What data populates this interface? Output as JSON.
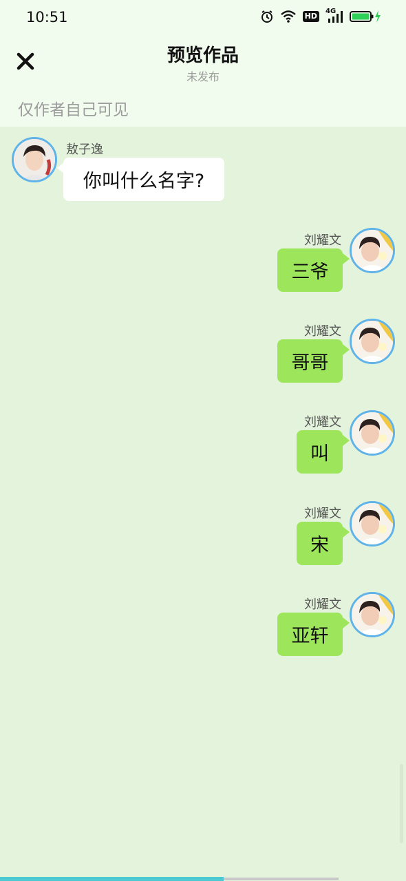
{
  "status_bar": {
    "time": "10:51",
    "hd_label": "HD",
    "network_label": "4G",
    "battery_color": "#2fd05a"
  },
  "header": {
    "title": "预览作品",
    "subtitle": "未发布",
    "visibility_note": "仅作者自己可见"
  },
  "messages": [
    {
      "side": "left",
      "sender": "敖子逸",
      "text": "你叫什么名字?"
    },
    {
      "side": "right",
      "sender": "刘耀文",
      "text": "三爷"
    },
    {
      "side": "right",
      "sender": "刘耀文",
      "text": "哥哥"
    },
    {
      "side": "right",
      "sender": "刘耀文",
      "text": "叫"
    },
    {
      "side": "right",
      "sender": "刘耀文",
      "text": "宋"
    },
    {
      "side": "right",
      "sender": "刘耀文",
      "text": "亚轩"
    }
  ],
  "colors": {
    "background": "#e4f4dc",
    "header": "#f1fcee",
    "right_bubble": "#9de65c",
    "left_bubble": "#ffffff",
    "avatar_ring": "#5fb3e8",
    "progress": "#4dc9d1"
  },
  "playback_progress": 0.55
}
